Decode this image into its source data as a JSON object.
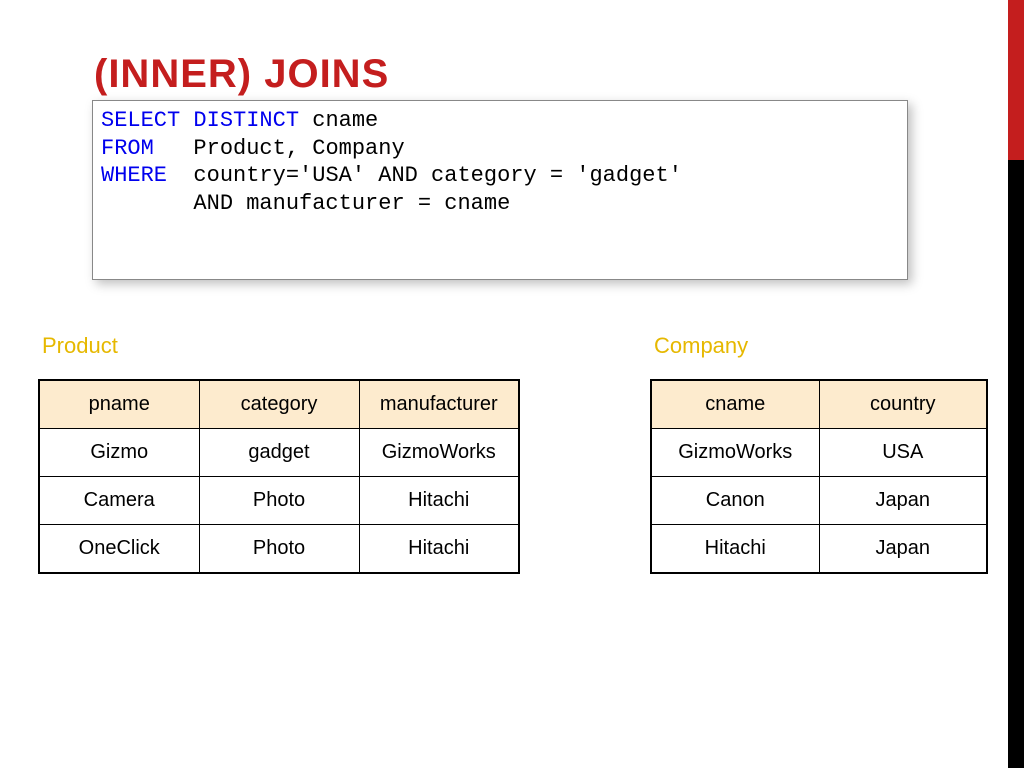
{
  "title": "(INNER) JOINS",
  "sql": {
    "kw_select": "SELECT",
    "kw_distinct": "DISTINCT",
    "select_rest": " cname",
    "kw_from": "FROM",
    "from_rest": "   Product, Company",
    "kw_where": "WHERE",
    "where_rest": "  country='USA' AND category = 'gadget'",
    "where_cont": "       AND manufacturer = cname"
  },
  "product": {
    "label": "Product",
    "headers": [
      "pname",
      "category",
      "manufacturer"
    ],
    "rows": [
      [
        "Gizmo",
        "gadget",
        "GizmoWorks"
      ],
      [
        "Camera",
        "Photo",
        "Hitachi"
      ],
      [
        "OneClick",
        "Photo",
        "Hitachi"
      ]
    ]
  },
  "company": {
    "label": "Company",
    "headers": [
      "cname",
      "country"
    ],
    "rows": [
      [
        "GizmoWorks",
        "USA"
      ],
      [
        "Canon",
        "Japan"
      ],
      [
        "Hitachi",
        "Japan"
      ]
    ]
  }
}
